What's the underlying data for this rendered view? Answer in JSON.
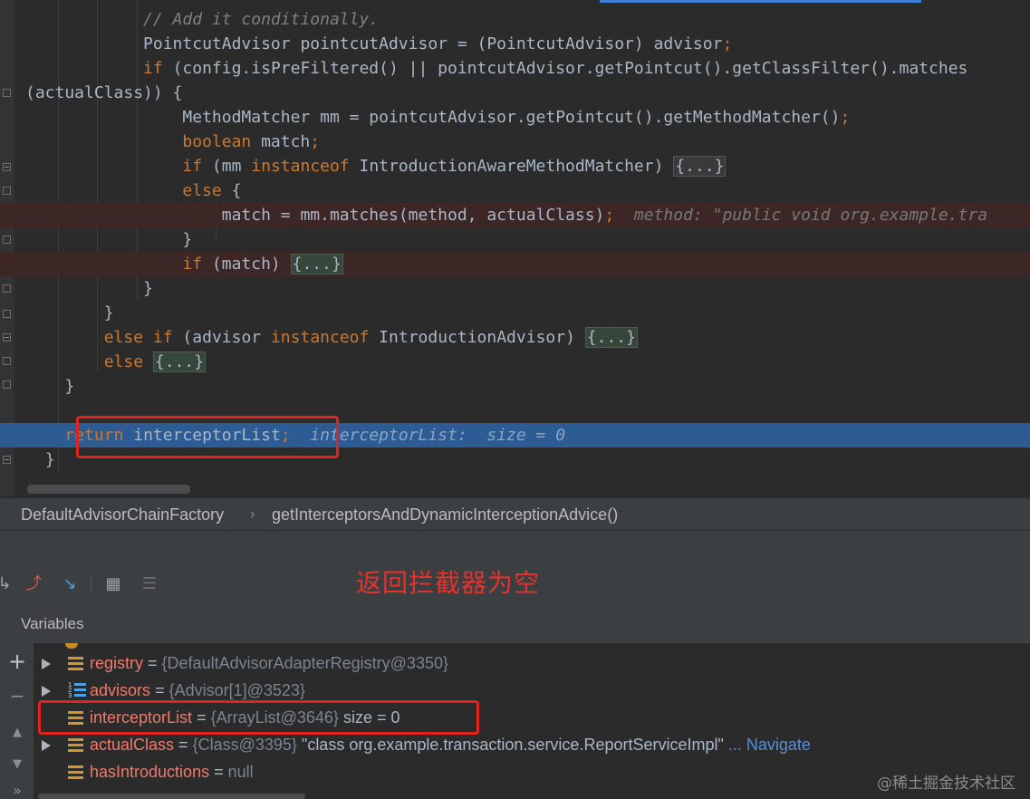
{
  "code": {
    "lines": [
      {
        "indent": "            ",
        "parts": [
          {
            "t": "// Add it conditionally.",
            "c": "cm"
          }
        ]
      },
      {
        "indent": "            ",
        "parts": [
          {
            "t": "PointcutAdvisor pointcutAdvisor = (PointcutAdvisor) advisor",
            "c": ""
          },
          {
            "t": ";",
            "c": "kw"
          }
        ]
      },
      {
        "indent": "            ",
        "parts": [
          {
            "t": "if",
            "c": "kw"
          },
          {
            "t": " (config.isPreFiltered() || pointcutAdvisor.getPointcut().getClassFilter().matches",
            "c": ""
          }
        ]
      },
      {
        "indent": "",
        "parts": [
          {
            "t": "(actualClass)) {",
            "c": ""
          }
        ]
      },
      {
        "indent": "                ",
        "parts": [
          {
            "t": "MethodMatcher mm = pointcutAdvisor.getPointcut().getMethodMatcher()",
            "c": ""
          },
          {
            "t": ";",
            "c": "kw"
          }
        ]
      },
      {
        "indent": "                ",
        "parts": [
          {
            "t": "boolean",
            "c": "kw"
          },
          {
            "t": " match",
            "c": ""
          },
          {
            "t": ";",
            "c": "kw"
          }
        ]
      },
      {
        "indent": "                ",
        "parts": [
          {
            "t": "if",
            "c": "kw"
          },
          {
            "t": " (mm ",
            "c": ""
          },
          {
            "t": "instanceof",
            "c": "kw"
          },
          {
            "t": " IntroductionAwareMethodMatcher) ",
            "c": ""
          },
          {
            "t": "{...}",
            "c": "fld gray"
          }
        ]
      },
      {
        "indent": "                ",
        "parts": [
          {
            "t": "else",
            "c": "kw"
          },
          {
            "t": " {",
            "c": ""
          }
        ]
      },
      {
        "indent": "                    ",
        "parts": [
          {
            "t": "match = mm.matches(method, actualClass)",
            "c": ""
          },
          {
            "t": ";",
            "c": "kw"
          },
          {
            "t": "  method: \"public void org.example.tra",
            "c": "hint"
          }
        ],
        "style": "err"
      },
      {
        "indent": "                ",
        "parts": [
          {
            "t": "}",
            "c": ""
          }
        ]
      },
      {
        "indent": "                ",
        "parts": [
          {
            "t": "if",
            "c": "kw"
          },
          {
            "t": " (match) ",
            "c": ""
          },
          {
            "t": "{...}",
            "c": "fld"
          }
        ],
        "style": "err"
      },
      {
        "indent": "            ",
        "parts": [
          {
            "t": "}",
            "c": ""
          }
        ]
      },
      {
        "indent": "        ",
        "parts": [
          {
            "t": "}",
            "c": ""
          }
        ]
      },
      {
        "indent": "        ",
        "parts": [
          {
            "t": "else",
            "c": "kw"
          },
          {
            "t": " ",
            "c": ""
          },
          {
            "t": "if",
            "c": "kw"
          },
          {
            "t": " (advisor ",
            "c": ""
          },
          {
            "t": "instanceof",
            "c": "kw"
          },
          {
            "t": " IntroductionAdvisor) ",
            "c": ""
          },
          {
            "t": "{...}",
            "c": "fld"
          }
        ]
      },
      {
        "indent": "        ",
        "parts": [
          {
            "t": "else",
            "c": "kw"
          },
          {
            "t": " ",
            "c": ""
          },
          {
            "t": "{...}",
            "c": "fld"
          }
        ]
      },
      {
        "indent": "    ",
        "parts": [
          {
            "t": "}",
            "c": ""
          }
        ]
      },
      {
        "indent": "",
        "parts": []
      },
      {
        "indent": "    ",
        "parts": [
          {
            "t": "return",
            "c": "kw"
          },
          {
            "t": " interceptorList",
            "c": ""
          },
          {
            "t": ";",
            "c": "kw"
          },
          {
            "t": "  interceptorList:  size = 0",
            "c": "hint"
          }
        ],
        "style": "cur"
      },
      {
        "indent": "  ",
        "parts": [
          {
            "t": "}",
            "c": ""
          }
        ]
      }
    ]
  },
  "breadcrumb": {
    "class_name": "DefaultAdvisorChainFactory",
    "method_name": "getInterceptorsAndDynamicInterceptionAdvice()"
  },
  "annotation": "返回拦截器为空",
  "variables": {
    "title": "Variables",
    "rows": [
      {
        "expand": true,
        "icon": "field",
        "name": "registry",
        "eq": " = ",
        "ref": "{DefaultAdvisorAdapterRegistry@3350}",
        "extra": "",
        "link": ""
      },
      {
        "expand": true,
        "icon": "array",
        "name": "advisors",
        "eq": " = ",
        "ref": "{Advisor[1]@3523}",
        "extra": "",
        "link": ""
      },
      {
        "expand": false,
        "icon": "field",
        "name": "interceptorList",
        "eq": " = ",
        "ref": "{ArrayList@3646}",
        "extra": "  size = 0",
        "link": ""
      },
      {
        "expand": true,
        "icon": "field",
        "name": "actualClass",
        "eq": " = ",
        "ref": "{Class@3395}",
        "extra": " \"class org.example.transaction.service.ReportServiceImpl\"",
        "link": " ... Navigate"
      },
      {
        "expand": false,
        "icon": "field",
        "name": "hasIntroductions",
        "eq": " = ",
        "ref": "null",
        "extra": "",
        "link": ""
      }
    ]
  },
  "watermark": "@稀土掘金技术社区"
}
